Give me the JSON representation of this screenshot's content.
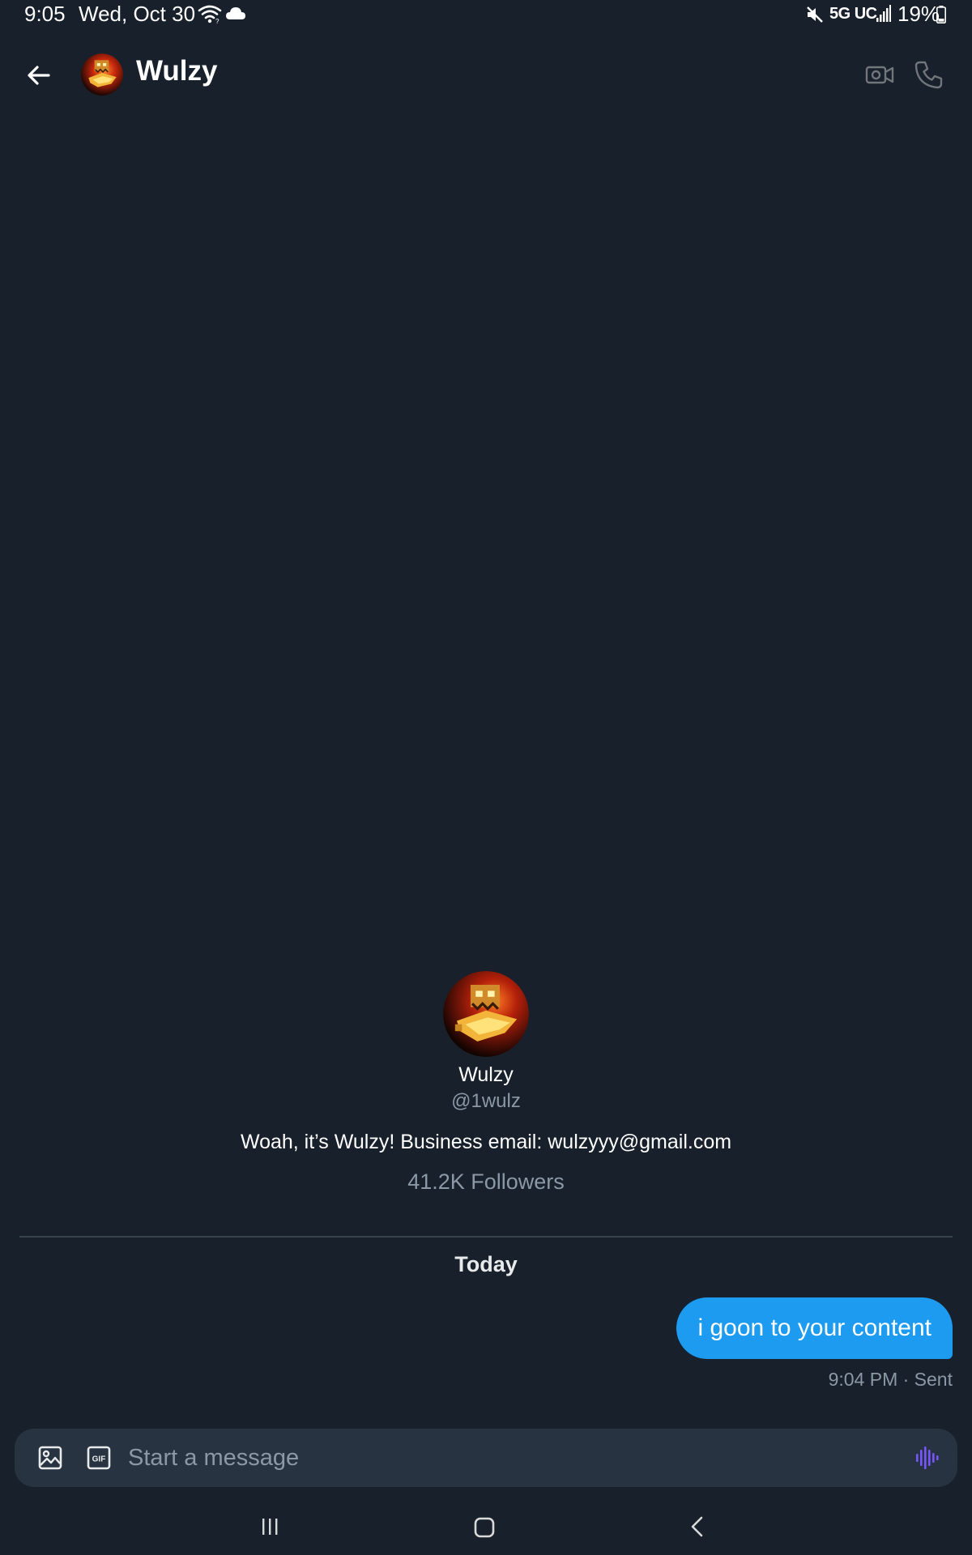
{
  "status_bar": {
    "time": "9:05",
    "date": "Wed, Oct 30",
    "network": "5G UC",
    "battery": "19%",
    "icons": [
      "wifi-icon",
      "cloud-icon",
      "mute-icon",
      "signal-icon",
      "battery-icon"
    ]
  },
  "header": {
    "title": "Wulzy",
    "icons": [
      "back-arrow-icon",
      "avatar",
      "video-camera-icon",
      "phone-icon"
    ]
  },
  "profile": {
    "name": "Wulzy",
    "handle": "@1wulz",
    "bio": "Woah, it’s Wulzy! Business email: wulzyyy@gmail.com",
    "followers": "41.2K Followers"
  },
  "conversation": {
    "date_separator": "Today",
    "messages": [
      {
        "text": "i goon to your content",
        "meta": "9:04 PM · Sent",
        "outgoing": true
      }
    ]
  },
  "composer": {
    "placeholder": "Start a message",
    "icons": [
      "image-icon",
      "gif-icon",
      "voice-waveform-icon"
    ]
  },
  "nav_bar": {
    "icons": [
      "recents-icon",
      "home-icon",
      "back-chevron-icon"
    ]
  },
  "colors": {
    "background": "#17202b",
    "bubble": "#1d9bf0",
    "secondary_text": "#8b98a5",
    "composer_bg": "#273340",
    "voice_accent": "#7856ff"
  }
}
